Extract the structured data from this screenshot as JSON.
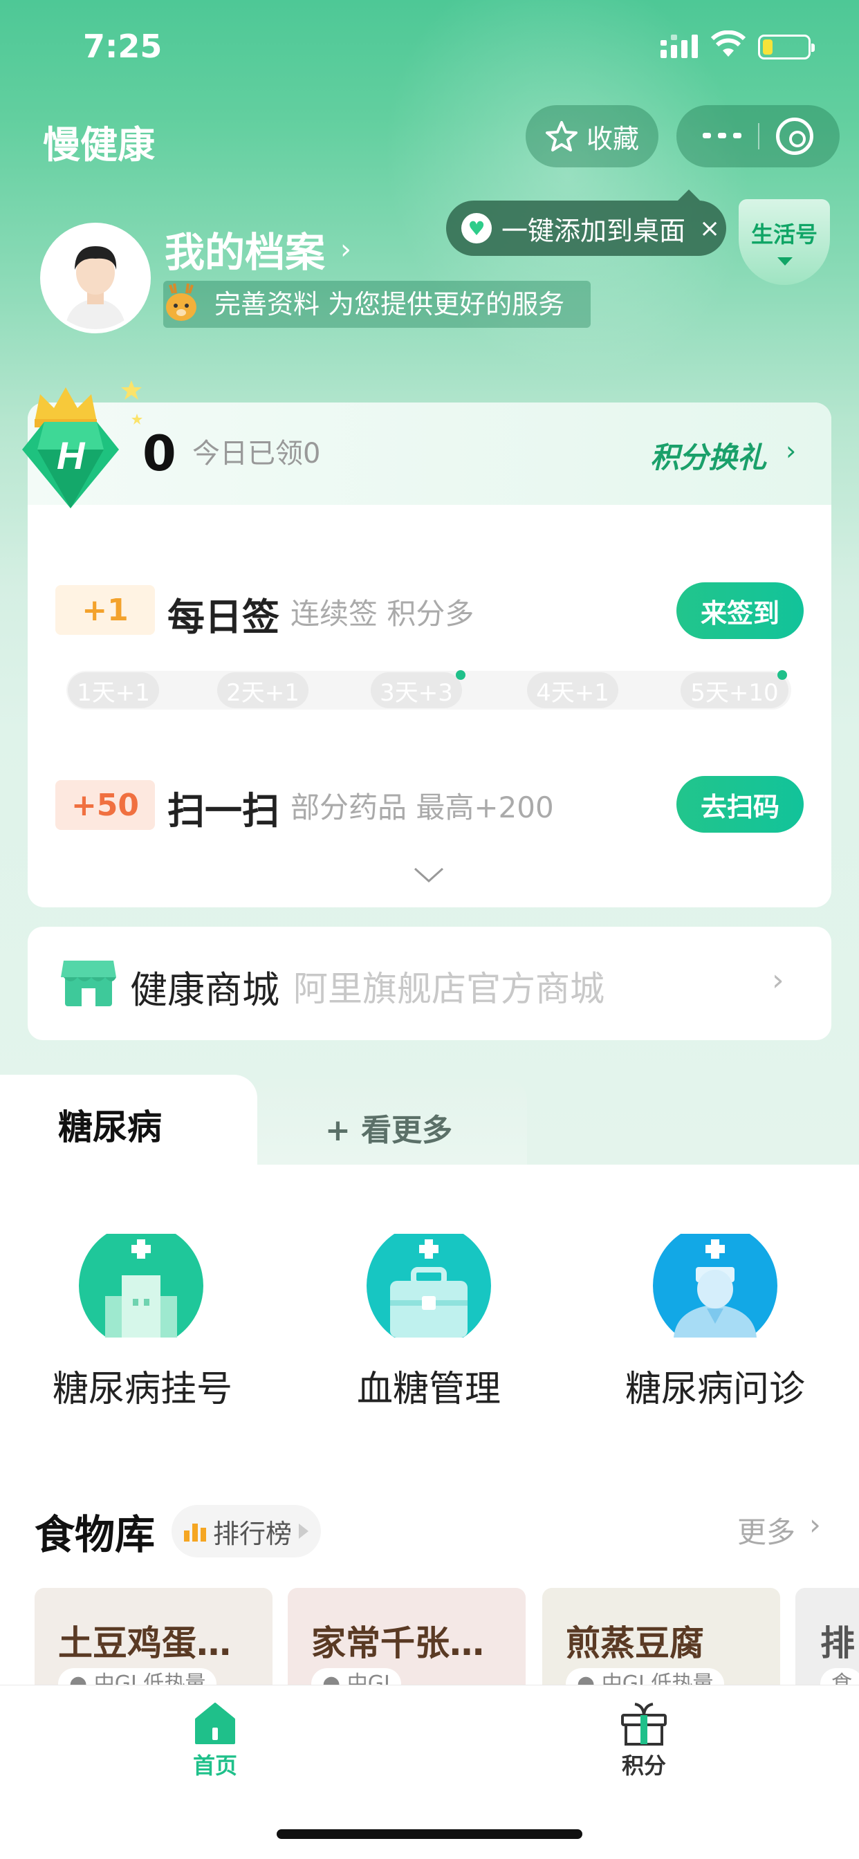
{
  "status_bar": {
    "time": "7:25"
  },
  "header": {
    "title": "慢健康",
    "favorite_label": "收藏"
  },
  "tooltip": {
    "text": "一键添加到桌面",
    "close": "×"
  },
  "life_tag": {
    "label": "生活号"
  },
  "profile": {
    "title": "我的档案",
    "arrow": "›",
    "subtitle": "完善资料 为您提供更好的服务"
  },
  "points": {
    "value": "0",
    "today_label": "今日已领0",
    "exchange_label": "积分换礼",
    "exchange_arrow": "›"
  },
  "tasks": [
    {
      "badge": "+1",
      "title": "每日签",
      "desc": "连续签 积分多",
      "button": "来签到"
    },
    {
      "badge": "+50",
      "title": "扫一扫",
      "desc": "部分药品 最高+200",
      "button": "去扫码"
    }
  ],
  "checkin_days": [
    "1天+1",
    "2天+1",
    "3天+3",
    "4天+1",
    "5天+10"
  ],
  "mall": {
    "title": "健康商城",
    "subtitle": "阿里旗舰店官方商城",
    "arrow": "›"
  },
  "disease_tabs": {
    "active": "糖尿病",
    "more": "+ 看更多"
  },
  "services": [
    {
      "label": "糖尿病挂号",
      "icon": "hospital-icon"
    },
    {
      "label": "血糖管理",
      "icon": "medkit-icon"
    },
    {
      "label": "糖尿病问诊",
      "icon": "doctor-icon"
    }
  ],
  "food": {
    "title": "食物库",
    "rank_label": "排行榜",
    "more_label": "更多",
    "more_arrow": "›",
    "cards": [
      {
        "name": "土豆鸡蛋…",
        "tag": "● 中GI 低热量"
      },
      {
        "name": "家常千张…",
        "tag": "● 中GI"
      },
      {
        "name": "煎蒸豆腐",
        "tag": "● 中GI 低热量"
      },
      {
        "name": "排",
        "tag": "食"
      }
    ]
  },
  "tabbar": {
    "home_label": "首页",
    "points_label": "积分"
  },
  "colors": {
    "brand": "#1fc08a",
    "header_green": "#4ec896",
    "badge_orange": "#f07040",
    "badge_yellow": "#f3a22c"
  }
}
